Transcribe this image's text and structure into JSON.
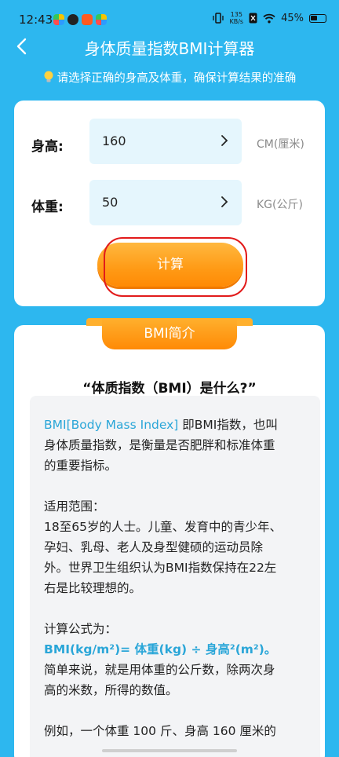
{
  "status_bar": {
    "time": "12:43",
    "net_speed_value": "135",
    "net_speed_unit": "KB/s",
    "battery": "45%"
  },
  "header": {
    "title": "身体质量指数BMI计算器",
    "tip": "请选择正确的身高及体重，确保计算结果的准确"
  },
  "form": {
    "height_label": "身高:",
    "height_value": "160",
    "height_unit": "CM(厘米)",
    "weight_label": "体重:",
    "weight_value": "50",
    "weight_unit": "KG(公斤)",
    "calc_button": "计算"
  },
  "intro": {
    "tab": "BMI简介",
    "question": "“体质指数（BMI）是什么?”",
    "p1_highlight": "BMI[Body Mass Index]",
    "p1_rest_line1": " 即BMI指数，也叫",
    "p1_line2": "身体质量指数，是衡量是否肥胖和标准体重",
    "p1_line3": "的重要指标。",
    "scope_title": "适用范围：",
    "scope_line1": "18至65岁的人士。儿童、发育中的青少年、",
    "scope_line2": "孕妇、乳母、老人及身型健硕的运动员除",
    "scope_line3": "外。世界卫生组织认为BMI指数保持在22左",
    "scope_line4": "右是比较理想的。",
    "formula_title": "计算公式为：",
    "formula": "BMI(kg/m²)= 体重(kg) ÷ 身高²(m²)。",
    "formula_line2": "简单来说，就是用体重的公斤数，除两次身",
    "formula_line3": "高的米数，所得的数值。",
    "example_line1": "例如，一个体重 100 斤、身高 160 厘米的"
  },
  "colors": {
    "background": "#2db7ef",
    "accent_orange": "#ff9a15",
    "accent_blue": "#2aa6d8",
    "highlight_red": "#e21b1b"
  }
}
